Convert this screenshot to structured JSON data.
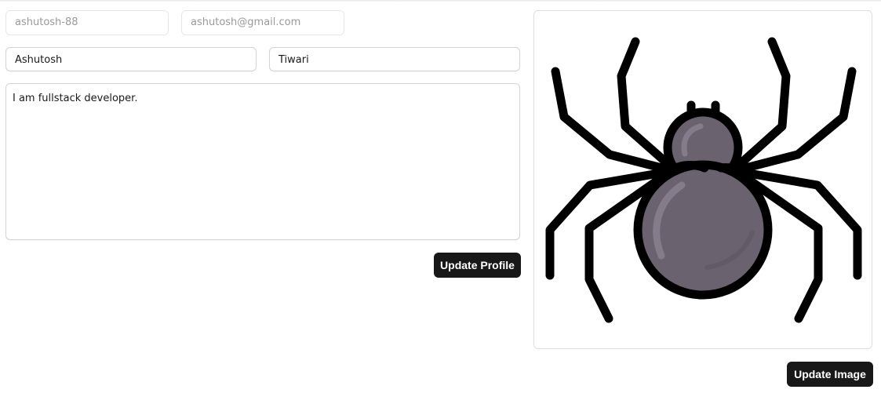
{
  "profile": {
    "username": "ashutosh-88",
    "email": "ashutosh@gmail.com",
    "first_name": "Ashutosh",
    "last_name": "Tiwari",
    "bio": "I am fullstack developer."
  },
  "buttons": {
    "update_profile": "Update Profile",
    "update_image": "Update Image"
  },
  "image": {
    "icon": "spider-icon",
    "body_color": "#6b6270",
    "outline_color": "#000000"
  },
  "colors": {
    "button_bg": "#181818",
    "button_text": "#ffffff"
  }
}
